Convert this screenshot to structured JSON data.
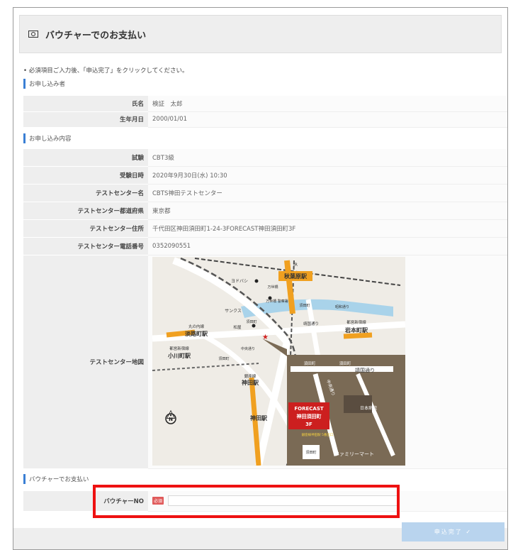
{
  "header": {
    "title": "バウチャーでのお支払い"
  },
  "instruction": "• 必須項目ご入力後、「申込完了」をクリックしてください。",
  "applicant": {
    "heading": "お申し込み者",
    "rows": [
      {
        "label": "氏名",
        "value": "検証　太郎"
      },
      {
        "label": "生年月日",
        "value": "2000/01/01"
      }
    ]
  },
  "details": {
    "heading": "お申し込み内容",
    "rows": [
      {
        "label": "試験",
        "value": "CBT3級"
      },
      {
        "label": "受験日時",
        "value": "2020年9月30日(水) 10:30"
      },
      {
        "label": "テストセンター名",
        "value": "CBTS神田テストセンター"
      },
      {
        "label": "テストセンター都道府県",
        "value": "東京都"
      },
      {
        "label": "テストセンター住所",
        "value": "千代田区神田須田町1-24-3FORECAST神田須田町3F"
      },
      {
        "label": "テストセンター電話番号",
        "value": "0352090551"
      }
    ],
    "map_label": "テストセンター地図"
  },
  "map": {
    "stations": {
      "akihabara": "秋葉原駅",
      "iwamotocho": "岩本町駅",
      "awajicho": "淡路町駅",
      "ogawamachi": "小川町駅",
      "kanda_small": "神田駅",
      "kanda": "神田駅"
    },
    "station_lines": {
      "iwamotocho": "都営新宿線",
      "awajicho": "丸の内線",
      "ogawamachi": "都営新宿線",
      "kanda_small": "銀座線",
      "jr": "JR"
    },
    "landmarks": {
      "yodobashi": "ヨドバシ",
      "manseibashi": "万世橋",
      "manseibashi_police": "万世橋\n警察署",
      "sunks": "サンクス",
      "matsuya": "松屋",
      "suda_a": "須田町",
      "suda_b": "須田町",
      "suda_c": "須田町",
      "suda_d": "須田町",
      "suda_e": "須田町",
      "yasukuni_a": "靖国通り",
      "yasukuni_b": "靖国通り",
      "showa": "昭和通り",
      "chuo_a": "中央通り",
      "chuo_b": "中央通り",
      "hospital": "日本病院",
      "familymart": "ファミリーマート",
      "exit": "銀座線神田駅\n5番出口"
    },
    "forecast": {
      "line1": "FORECAST",
      "line2": "神田須田町",
      "line3": "3F"
    },
    "compass": "N"
  },
  "voucher": {
    "heading": "バウチャーでお支払い",
    "label": "バウチャーNO",
    "required_badge": "必須",
    "input_value": ""
  },
  "actions": {
    "submit_label": "申込完了 ✓"
  },
  "colors": {
    "accent": "#3a7fd4",
    "highlight": "#ee1111",
    "button": "#b9d4ee"
  }
}
